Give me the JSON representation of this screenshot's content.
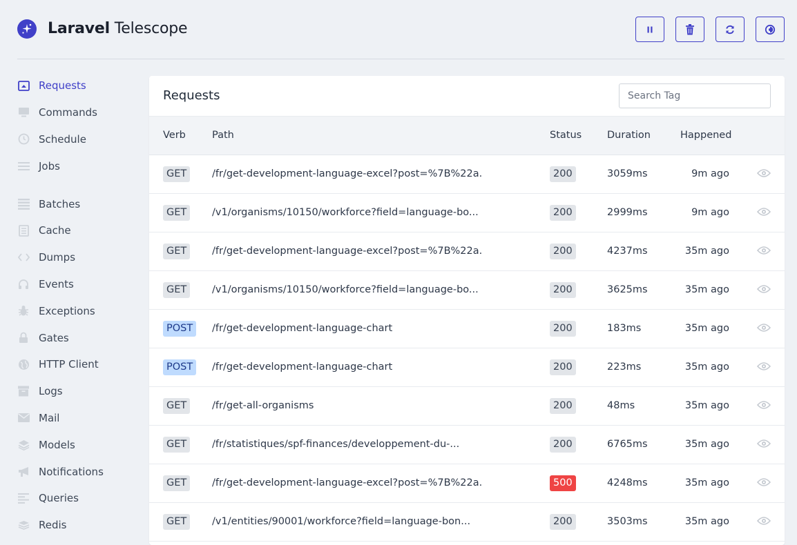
{
  "app": {
    "brand_bold": "Laravel",
    "brand_light": " Telescope"
  },
  "toolbar": [
    {
      "name": "pause-button",
      "icon": "pause-icon"
    },
    {
      "name": "clear-entries-button",
      "icon": "trash-icon"
    },
    {
      "name": "refresh-button",
      "icon": "refresh-icon"
    },
    {
      "name": "theme-toggle-button",
      "icon": "theme-icon"
    }
  ],
  "sidebar": {
    "items": [
      {
        "label": "Requests",
        "icon": "request-icon",
        "active": true
      },
      {
        "label": "Commands",
        "icon": "monitor-icon"
      },
      {
        "label": "Schedule",
        "icon": "clock-icon"
      },
      {
        "label": "Jobs",
        "icon": "list-icon"
      },
      {
        "label": "Batches",
        "icon": "batches-icon"
      },
      {
        "label": "Cache",
        "icon": "cache-icon"
      },
      {
        "label": "Dumps",
        "icon": "code-icon"
      },
      {
        "label": "Events",
        "icon": "headphones-icon"
      },
      {
        "label": "Exceptions",
        "icon": "bug-icon"
      },
      {
        "label": "Gates",
        "icon": "lock-icon"
      },
      {
        "label": "HTTP Client",
        "icon": "globe-icon"
      },
      {
        "label": "Logs",
        "icon": "archive-icon"
      },
      {
        "label": "Mail",
        "icon": "envelope-icon"
      },
      {
        "label": "Models",
        "icon": "layers-icon"
      },
      {
        "label": "Notifications",
        "icon": "megaphone-icon"
      },
      {
        "label": "Queries",
        "icon": "queries-icon"
      },
      {
        "label": "Redis",
        "icon": "redis-icon"
      }
    ]
  },
  "panel": {
    "title": "Requests",
    "search_placeholder": "Search Tag",
    "columns": {
      "verb": "Verb",
      "path": "Path",
      "status": "Status",
      "duration": "Duration",
      "happened": "Happened"
    },
    "rows": [
      {
        "verb": "GET",
        "path": "/fr/get-development-language-excel?post=%7B%22a...",
        "status": "200",
        "duration": "3059ms",
        "happened": "9m ago"
      },
      {
        "verb": "GET",
        "path": "/v1/organisms/10150/workforce?field=language-bo...",
        "status": "200",
        "duration": "2999ms",
        "happened": "9m ago"
      },
      {
        "verb": "GET",
        "path": "/fr/get-development-language-excel?post=%7B%22a...",
        "status": "200",
        "duration": "4237ms",
        "happened": "35m ago"
      },
      {
        "verb": "GET",
        "path": "/v1/organisms/10150/workforce?field=language-bo...",
        "status": "200",
        "duration": "3625ms",
        "happened": "35m ago"
      },
      {
        "verb": "POST",
        "path": "/fr/get-development-language-chart",
        "status": "200",
        "duration": "183ms",
        "happened": "35m ago"
      },
      {
        "verb": "POST",
        "path": "/fr/get-development-language-chart",
        "status": "200",
        "duration": "223ms",
        "happened": "35m ago"
      },
      {
        "verb": "GET",
        "path": "/fr/get-all-organisms",
        "status": "200",
        "duration": "48ms",
        "happened": "35m ago"
      },
      {
        "verb": "GET",
        "path": "/fr/statistiques/spf-finances/developpement-du-...",
        "status": "200",
        "duration": "6765ms",
        "happened": "35m ago"
      },
      {
        "verb": "GET",
        "path": "/fr/get-development-language-excel?post=%7B%22a...",
        "status": "500",
        "duration": "4248ms",
        "happened": "35m ago"
      },
      {
        "verb": "GET",
        "path": "/v1/entities/90001/workforce?field=language-bon...",
        "status": "200",
        "duration": "3503ms",
        "happened": "35m ago"
      }
    ]
  },
  "colors": {
    "accent": "#4040c8",
    "error": "#ef4444",
    "post_badge": "#bfdbfe",
    "neutral_badge": "#e2e5e9"
  }
}
